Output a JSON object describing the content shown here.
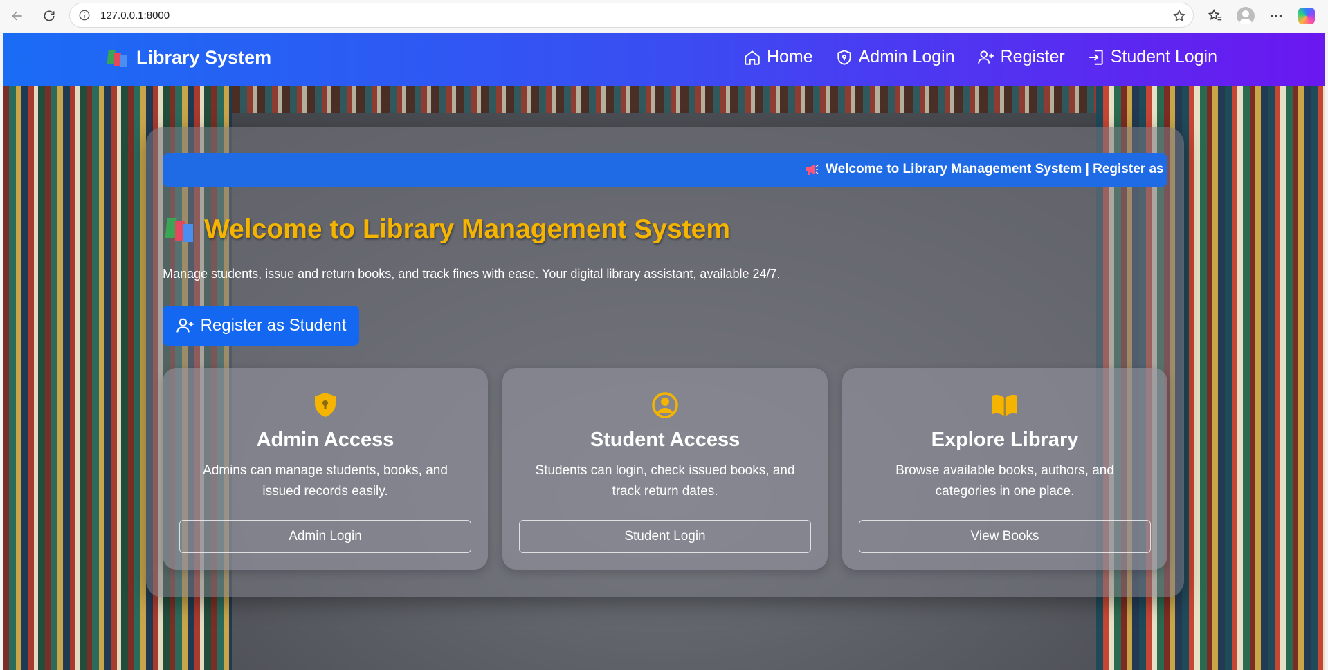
{
  "browser": {
    "url": "127.0.0.1:8000",
    "icons": [
      "back-icon",
      "reload-icon",
      "info-icon",
      "star-icon",
      "favorites-icon",
      "profile-icon",
      "more-icon",
      "copilot-icon"
    ]
  },
  "navbar": {
    "brand": "Library System",
    "links": [
      {
        "label": "Home",
        "icon": "home-icon"
      },
      {
        "label": "Admin Login",
        "icon": "shield-icon"
      },
      {
        "label": "Register",
        "icon": "person-add-icon"
      },
      {
        "label": "Student Login",
        "icon": "login-icon"
      }
    ],
    "gradient": [
      "#1a6cf5",
      "#6a18f0"
    ]
  },
  "hero": {
    "marquee": "Welcome to Library Management System | Register as",
    "title": "Welcome to Library Management System",
    "subtitle": "Manage students, issue and return books, and track fines with ease. Your digital library assistant, available 24/7.",
    "register_button": "Register as Student"
  },
  "cards": [
    {
      "title": "Admin Access",
      "desc": "Admins can manage students, books, and issued records easily.",
      "button": "Admin Login",
      "icon": "shield-lock-icon"
    },
    {
      "title": "Student Access",
      "desc": "Students can login, check issued books, and track return dates.",
      "button": "Student Login",
      "icon": "user-circle-icon"
    },
    {
      "title": "Explore Library",
      "desc": "Browse available books, authors, and categories in one place.",
      "button": "View Books",
      "icon": "open-book-icon"
    }
  ],
  "colors": {
    "accent_yellow": "#f5b400",
    "primary_blue": "#1367f0",
    "marquee_blue": "#1f6be6"
  }
}
